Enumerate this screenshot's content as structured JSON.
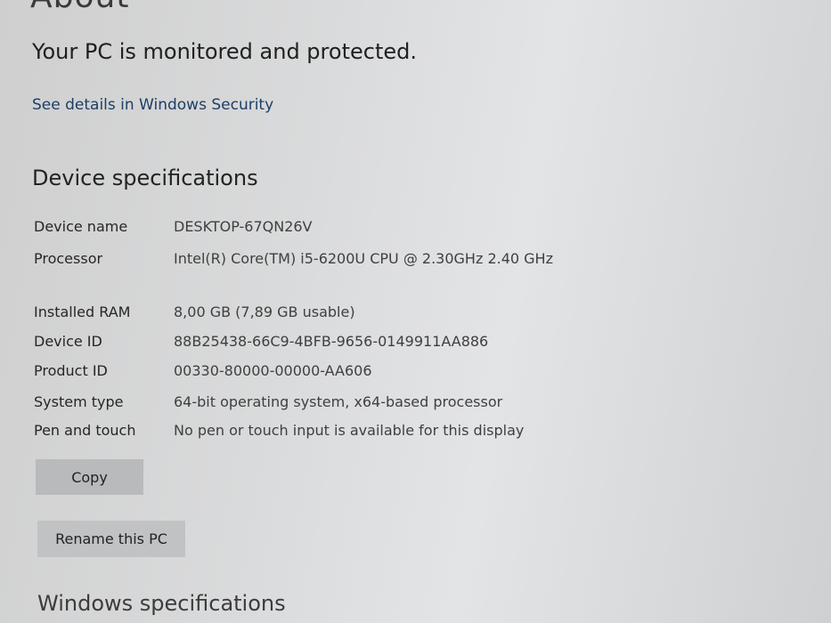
{
  "page": {
    "heading": "About",
    "protection_status": "Your PC is monitored and protected.",
    "security_link": "See details in Windows Security"
  },
  "device_specifications": {
    "title": "Device specifications",
    "rows": [
      {
        "label": "Device name",
        "value": "DESKTOP-67QN26V"
      },
      {
        "label": "Processor",
        "value": "Intel(R) Core(TM) i5-6200U CPU @ 2.30GHz   2.40 GHz"
      },
      {
        "label": "Installed RAM",
        "value": "8,00 GB (7,89 GB usable)"
      },
      {
        "label": "Device ID",
        "value": "88B25438-66C9-4BFB-9656-0149911AA886"
      },
      {
        "label": "Product ID",
        "value": "00330-80000-00000-AA606"
      },
      {
        "label": "System type",
        "value": "64-bit operating system, x64-based processor"
      },
      {
        "label": "Pen and touch",
        "value": "No pen or touch input is available for this display"
      }
    ],
    "copy_button": "Copy"
  },
  "actions": {
    "rename_button": "Rename this PC"
  },
  "windows_specifications": {
    "title": "Windows specifications"
  },
  "colors": {
    "link": "#1d3f66",
    "button_bg": "#b9babc"
  }
}
